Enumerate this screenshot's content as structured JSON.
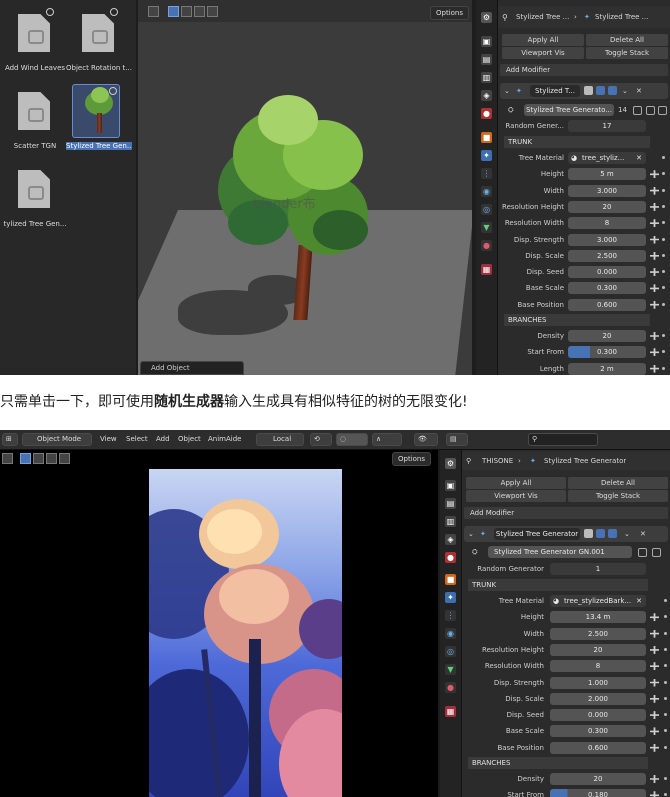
{
  "shot1": {
    "assets": [
      {
        "label": "Add Wind Leaves",
        "icon": "document-icon"
      },
      {
        "label": "Object Rotation t...",
        "icon": "document-icon"
      },
      {
        "label": "Scatter TGN",
        "icon": "document-icon"
      },
      {
        "label": "Stylized Tree Gen...",
        "icon": "tree-thumbnail",
        "selected": true
      },
      {
        "label": "tylized Tree Gen...",
        "icon": "document-icon"
      }
    ],
    "viewport": {
      "options_label": "Options",
      "watermark": "blender布",
      "add_object": "Add Object"
    },
    "breadcrumb": {
      "object": "Stylized Tree ...",
      "modifier": "Stylized Tree ..."
    },
    "buttons": {
      "apply_all": "Apply All",
      "delete_all": "Delete All",
      "viewport_vis": "Viewport Vis",
      "toggle_stack": "Toggle Stack",
      "add_modifier": "Add Modifier"
    },
    "modifier": {
      "name": "Stylized T...",
      "node_group": "Stylized Tree Generato...",
      "users": "14",
      "random_label": "Random Gener...",
      "random_value": "17"
    },
    "trunk_title": "TRUNK",
    "trunk": [
      {
        "label": "Tree Material",
        "value": "tree_styliz...",
        "material": true
      },
      {
        "label": "Height",
        "value": "5 m"
      },
      {
        "label": "Width",
        "value": "3.000"
      },
      {
        "label": "Resolution Height",
        "value": "20"
      },
      {
        "label": "Resolution Width",
        "value": "8"
      },
      {
        "label": "Disp. Strength",
        "value": "3.000"
      },
      {
        "label": "Disp. Scale",
        "value": "2.500"
      },
      {
        "label": "Disp. Seed",
        "value": "0.000"
      },
      {
        "label": "Base Scale",
        "value": "0.300"
      },
      {
        "label": "Base Position",
        "value": "0.600"
      }
    ],
    "branches_title": "BRANCHES",
    "branches": [
      {
        "label": "Density",
        "value": "20"
      },
      {
        "label": "Start From",
        "value": "0.300",
        "fill": 0.28
      },
      {
        "label": "Length",
        "value": "2 m"
      }
    ]
  },
  "caption": {
    "before": "只需单击一下，即可使用",
    "bold": "随机生成器",
    "after": "输入生成具有相似特征的树的无限变化!"
  },
  "shot2": {
    "header": {
      "mode": "Object Mode",
      "menus": [
        "View",
        "Select",
        "Add",
        "Object",
        "AnimAide"
      ],
      "transform": "Local",
      "options_label": "Options"
    },
    "breadcrumb": {
      "object": "THISONE",
      "modifier": "Stylized Tree Generator"
    },
    "buttons": {
      "apply_all": "Apply All",
      "delete_all": "Delete All",
      "viewport_vis": "Viewport Vis",
      "toggle_stack": "Toggle Stack",
      "add_modifier": "Add Modifier"
    },
    "modifier": {
      "name": "Stylized Tree Generator",
      "node_group": "Stylized Tree Generator GN.001",
      "random_label": "Random Generator",
      "random_value": "1"
    },
    "trunk_title": "TRUNK",
    "trunk": [
      {
        "label": "Tree Material",
        "value": "tree_stylizedBark...",
        "material": true
      },
      {
        "label": "Height",
        "value": "13.4 m"
      },
      {
        "label": "Width",
        "value": "2.500"
      },
      {
        "label": "Resolution Height",
        "value": "20"
      },
      {
        "label": "Resolution Width",
        "value": "8"
      },
      {
        "label": "Disp. Strength",
        "value": "1.000"
      },
      {
        "label": "Disp. Scale",
        "value": "2.000"
      },
      {
        "label": "Disp. Seed",
        "value": "0.000"
      },
      {
        "label": "Base Scale",
        "value": "0.300"
      },
      {
        "label": "Base Position",
        "value": "0.600"
      }
    ],
    "branches_title": "BRANCHES",
    "branches": [
      {
        "label": "Density",
        "value": "20"
      },
      {
        "label": "Start From",
        "value": "0.180",
        "fill": 0.18
      }
    ]
  },
  "colors": {
    "accent": "#4772b3",
    "panel": "#2b2b2b",
    "field": "#545454"
  }
}
